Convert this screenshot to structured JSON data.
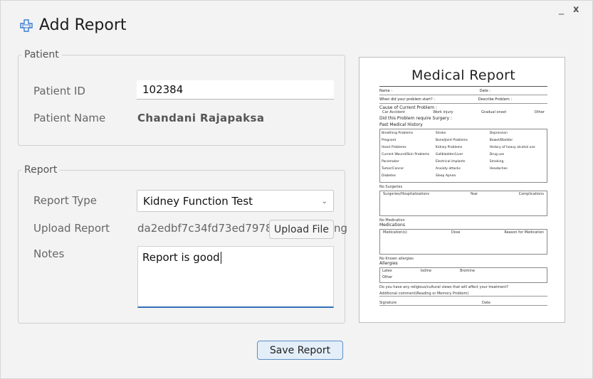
{
  "window": {
    "title": "Add Report",
    "minimize": "_",
    "close": "x"
  },
  "patient": {
    "legend": "Patient",
    "id_label": "Patient ID",
    "id_value": "102384",
    "name_label": "Patient Name",
    "name_value": "Chandani Rajapaksa"
  },
  "report": {
    "legend": "Report",
    "type_label": "Report Type",
    "type_value": "Kidney Function Test",
    "upload_label": "Upload Report",
    "upload_value": "da2edbf7c34fd73ed797842",
    "upload_suffix": "ng",
    "upload_button": "Upload File",
    "notes_label": "Notes",
    "notes_value": "Report is good"
  },
  "save_button": "Save Report",
  "preview": {
    "title": "Medical Report",
    "fields": [
      "Name :",
      "Date :",
      "When did your problem start? :",
      "Describe Problem :"
    ],
    "cause_heading": "Cause of Current Problem :",
    "cause_options": [
      "Car Accident",
      "Work injury",
      "Gradual onset",
      "Other"
    ],
    "surgery_q": "Did this Problem require Surgery :",
    "history_heading": "Past Medical History",
    "history_items": [
      "Breathing Problems",
      "Stroke",
      "Depression",
      "Pregnant",
      "Bone/Joint Problems",
      "Bowel/Bladder",
      "Heart Problems",
      "Kidney Problems",
      "History of heavy alcohol use",
      "Current Wound/Skin Problems",
      "Gallbladder/Liver",
      "Drug use",
      "Pacemaker",
      "Electrical implants",
      "Smoking",
      "Tumor/Cancer",
      "Anxiety attacks",
      "Headaches",
      "Diabetes",
      "Sleep Apnea"
    ],
    "no_surgeries": "No Surgeries",
    "surgery_cols": [
      "Surgeries/Hospitalizations",
      "Year",
      "Complications"
    ],
    "no_medication": "No Medication",
    "medications_heading": "Medications",
    "med_cols": [
      "Medication(s)",
      "Dose",
      "Reason for Medication"
    ],
    "no_allergies": "No Known allergies",
    "allergies_heading": "Allergies",
    "allergy_items": [
      "Latex",
      "Iodine",
      "Bromine",
      "Other"
    ],
    "religious_q": "Do you have any religious/cultural views that will affect your treatment?",
    "additional": "Additional comment(Reading or Memory Problem)",
    "signature": "Signature",
    "date": "Date"
  }
}
